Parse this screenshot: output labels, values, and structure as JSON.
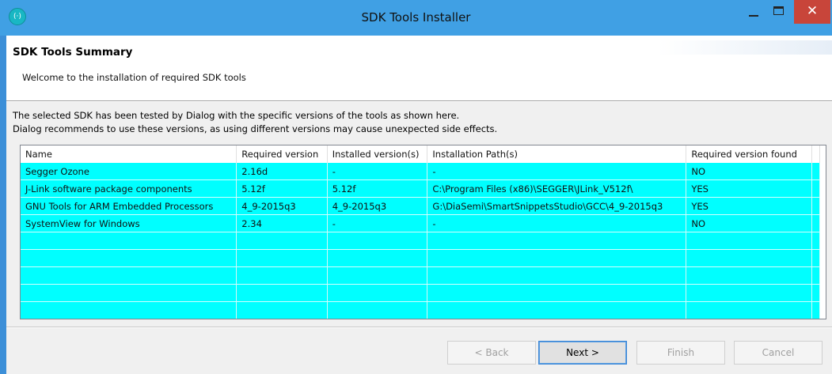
{
  "window": {
    "title": "SDK Tools Installer",
    "app_icon_text": "(·)",
    "close_glyph": "✕"
  },
  "header": {
    "title": "SDK Tools Summary",
    "subtitle": "Welcome to the installation of required SDK tools"
  },
  "description": {
    "line1": "The selected SDK has been tested by Dialog with the specific versions of the tools as shown here.",
    "line2": "Dialog recommends to use these versions, as using different versions may cause unexpected side effects."
  },
  "table": {
    "columns": [
      "Name",
      "Required version",
      "Installed version(s)",
      "Installation Path(s)",
      "Required version found"
    ],
    "rows": [
      [
        "Segger Ozone",
        "2.16d",
        "-",
        "-",
        "NO"
      ],
      [
        "J-Link software package components",
        "5.12f",
        "5.12f",
        "C:\\Program Files (x86)\\SEGGER\\JLink_V512f\\",
        "YES"
      ],
      [
        "GNU Tools for ARM Embedded Processors",
        "4_9-2015q3",
        "4_9-2015q3",
        "G:\\DiaSemi\\SmartSnippetsStudio\\GCC\\4_9-2015q3",
        "YES"
      ],
      [
        "SystemView for Windows",
        "2.34",
        "-",
        "-",
        "NO"
      ]
    ],
    "row_color": "#00ffff"
  },
  "buttons": {
    "back": "< Back",
    "next": "Next >",
    "finish": "Finish",
    "cancel": "Cancel"
  },
  "colors": {
    "titlebar": "#40a0e4",
    "close_button": "#c8453a",
    "table_row_highlight": "#00ffff"
  }
}
